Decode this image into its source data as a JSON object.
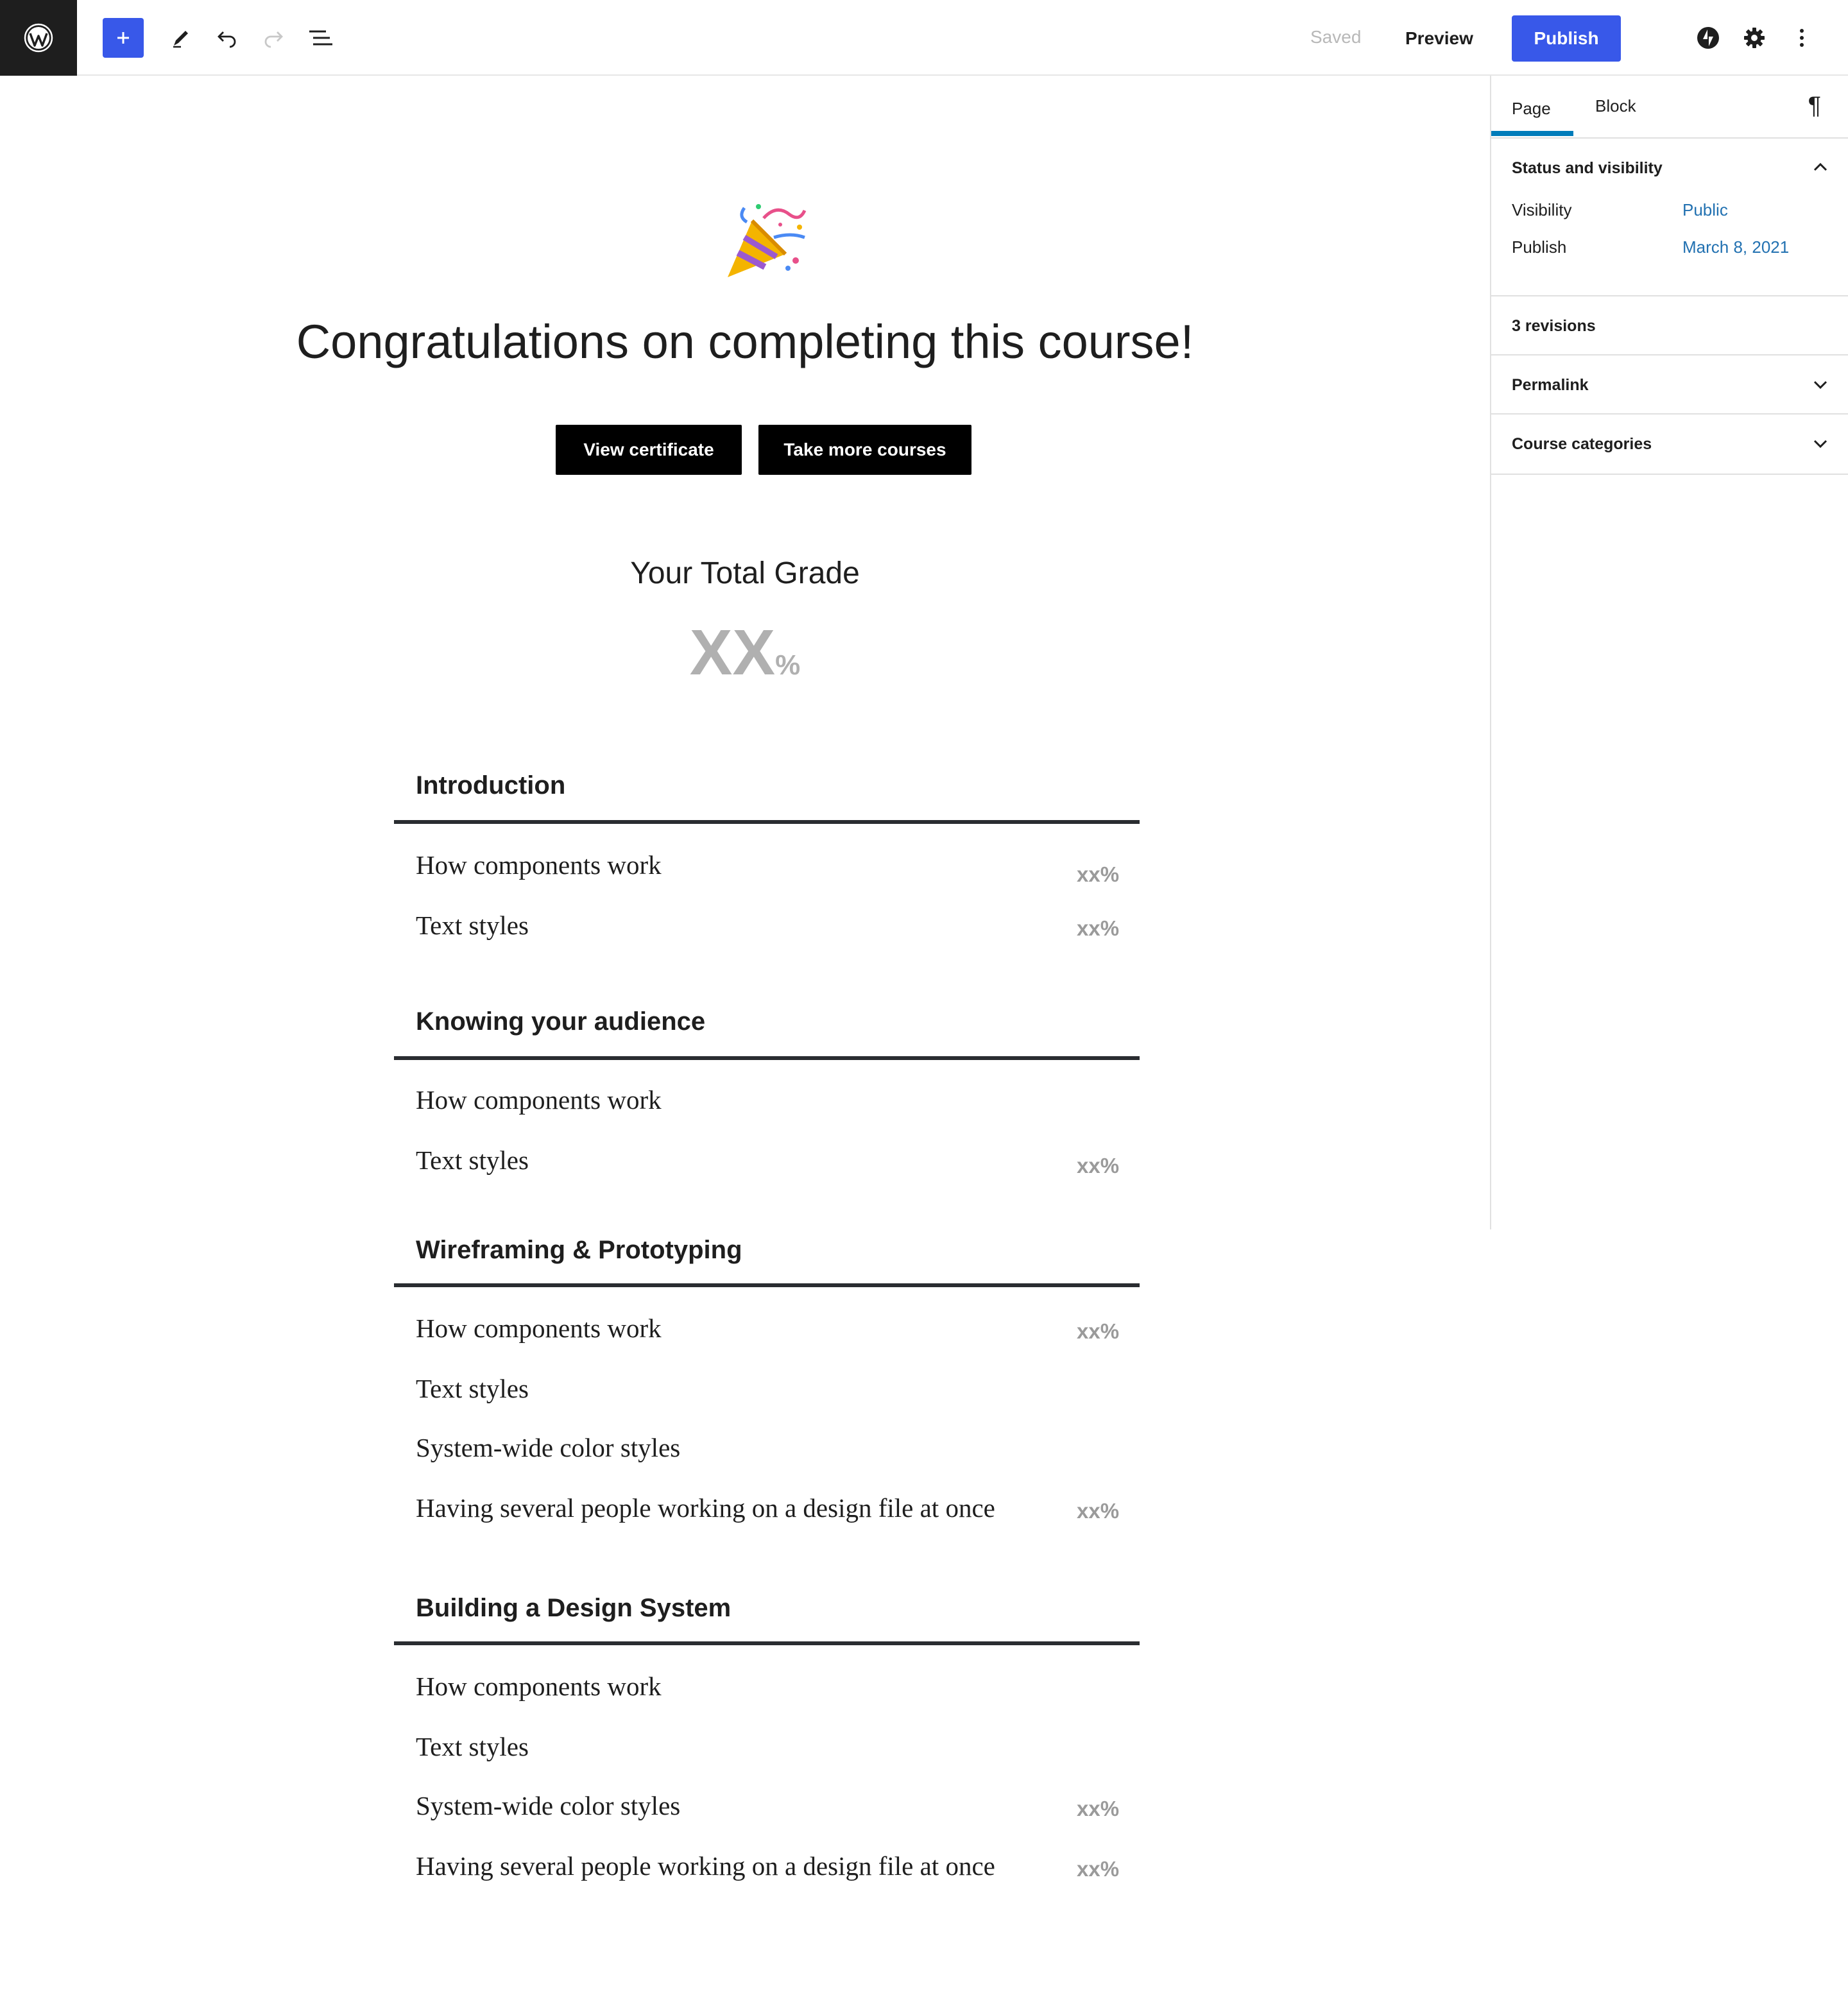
{
  "toolbar": {
    "saved_label": "Saved",
    "preview_label": "Preview",
    "publish_label": "Publish",
    "icons": [
      "wordpress-logo-icon",
      "plus-icon",
      "pencil-icon",
      "undo-icon",
      "redo-icon",
      "list-view-icon",
      "jetpack-icon",
      "gear-icon",
      "more-vertical-icon"
    ],
    "accent_color": "#3858e9"
  },
  "sidebar": {
    "tabs": [
      "Page",
      "Block"
    ],
    "active_tab": "Page",
    "status_panel": {
      "title": "Status and visibility",
      "visibility_label": "Visibility",
      "visibility_value": "Public",
      "publish_label": "Publish",
      "publish_value": "March 8, 2021"
    },
    "revisions": "3 revisions",
    "permalink": "Permalink",
    "course_categories": "Course categories",
    "link_color": "#2271b1"
  },
  "content": {
    "heading": "Congratulations on completing this course!",
    "buttons": [
      "View certificate",
      "Take more courses"
    ],
    "grade": {
      "title": "Your Total Grade",
      "value": "XX",
      "unit": "%"
    },
    "sections": [
      {
        "title": "Introduction",
        "lessons": [
          {
            "name": "How components work",
            "score": "xx%"
          },
          {
            "name": "Text styles",
            "score": "xx%"
          }
        ]
      },
      {
        "title": "Knowing your audience",
        "lessons": [
          {
            "name": "How components work",
            "score": ""
          },
          {
            "name": "Text styles",
            "score": "xx%"
          }
        ]
      },
      {
        "title": "Wireframing & Prototyping",
        "lessons": [
          {
            "name": "How components work",
            "score": "xx%"
          },
          {
            "name": "Text styles",
            "score": ""
          },
          {
            "name": "System-wide color styles",
            "score": ""
          },
          {
            "name": "Having several people working on a design file at once",
            "score": "xx%"
          }
        ]
      },
      {
        "title": "Building a Design System",
        "lessons": [
          {
            "name": "How components work",
            "score": ""
          },
          {
            "name": "Text styles",
            "score": ""
          },
          {
            "name": "System-wide color styles",
            "score": "xx%"
          },
          {
            "name": "Having several people working on a design file at once",
            "score": "xx%"
          }
        ]
      }
    ]
  }
}
